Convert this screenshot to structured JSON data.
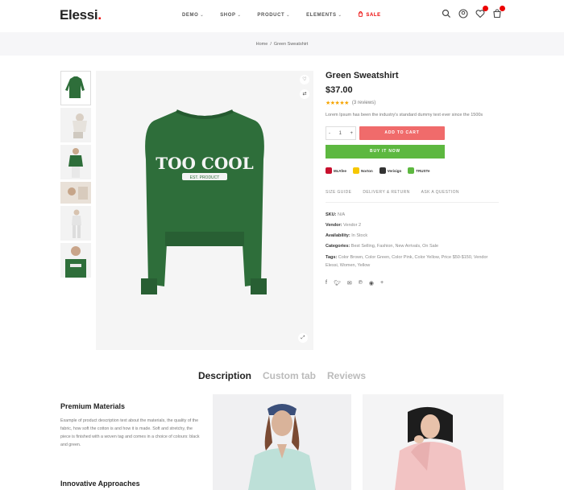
{
  "header": {
    "logo": "Elessi",
    "logo_dot": ".",
    "nav": [
      {
        "label": "DEMO",
        "chevron": true
      },
      {
        "label": "SHOP",
        "chevron": true
      },
      {
        "label": "PRODUCT",
        "chevron": true
      },
      {
        "label": "ELEMENTS",
        "chevron": true
      },
      {
        "label": "SALE",
        "chevron": false
      }
    ],
    "icons": [
      "search-icon",
      "user-icon",
      "heart-icon",
      "cart-icon"
    ],
    "accent": "#ec0101"
  },
  "breadcrumb": {
    "items": [
      "Home",
      "Green Sweatshirt"
    ],
    "separator": "/"
  },
  "gallery": {
    "thumb_count": 6,
    "main_print": [
      "TOO COOL",
      "EST. PRODUCT"
    ],
    "sweater_color": "#2e6e3a"
  },
  "product": {
    "title": "Green Sweatshirt",
    "price": "$37.00",
    "stars": "★★★★★",
    "rating_value": 4.5,
    "reviews": "(3 reviews)",
    "description": "Lorem Ipsum has been the industry's standard dummy text ever since the 1500s",
    "qty": "1",
    "qty_minus": "-",
    "qty_plus": "+",
    "add_to_cart": "ADD TO CART",
    "buy_now": "BUY IT NOW",
    "add_to_cart_color": "#f06b6b",
    "buy_now_color": "#5db840",
    "payments": [
      {
        "label": "McAfee",
        "color": "#c8102e"
      },
      {
        "label": "Norton",
        "color": "#f6c700"
      },
      {
        "label": "Verisign",
        "color": "#333333"
      },
      {
        "label": "TRUSTe",
        "color": "#5db840"
      }
    ],
    "links": [
      "SIZE GUIDE",
      "DELIVERY & RETURN",
      "ASK A QUESTION"
    ],
    "meta": [
      {
        "label": "SKU:",
        "value": "N/A"
      },
      {
        "label": "Vendor:",
        "value": "Vendor 2"
      },
      {
        "label": "Availability:",
        "value": "In Stock"
      },
      {
        "label": "Categories:",
        "value": "Best Selling, Fashion, New Arrivals, On Sale"
      },
      {
        "label": "Tags:",
        "value": "Color Brown, Color Green, Color Pink, Color Yellow, Price $50-$150, Vendor Elessi, Women, Yellow"
      }
    ],
    "share": [
      "facebook-icon",
      "twitter-icon",
      "email-icon",
      "pinterest-icon",
      "messenger-icon",
      "more-icon"
    ]
  },
  "tabs": [
    {
      "label": "Description",
      "active": true
    },
    {
      "label": "Custom tab",
      "active": false
    },
    {
      "label": "Reviews",
      "active": false
    }
  ],
  "details": {
    "heading1": "Premium Materials",
    "para1": "Example of product description text about the materials, the quality of the fabric, how soft the cotton is and how it is made. Soft and stretchy, the piece is finished with a woven tag and comes in a choice of colours: black and green.",
    "heading2": "Innovative Approaches"
  }
}
